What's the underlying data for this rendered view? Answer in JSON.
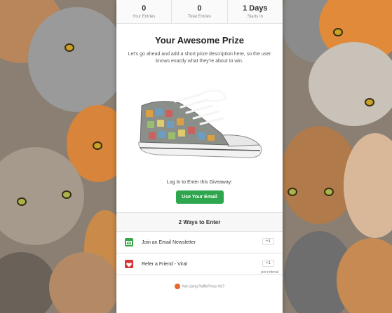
{
  "stats": [
    {
      "value": "0",
      "label": "Your Entries"
    },
    {
      "value": "0",
      "label": "Total Entries"
    },
    {
      "value": "1 Days",
      "label": "Starts In"
    }
  ],
  "prize": {
    "title": "Your Awesome Prize",
    "description": "Let's go ahead and add a short prize description here, so the user knows exactly what they're about to win.",
    "image_icon": "sneaker-image"
  },
  "login": {
    "prompt": "Log In to Enter this Giveaway:",
    "email_button": "Use Your Email"
  },
  "ways": {
    "header": "2 Ways to Enter",
    "items": [
      {
        "label": "Join an Email Newsletter",
        "points": "+1",
        "sub": "",
        "icon": "mail-icon",
        "color": "#3aa54a"
      },
      {
        "label": "Refer a Friend - Viral",
        "points": "+1",
        "sub": "per referral",
        "icon": "heart-icon",
        "color": "#d9343a"
      }
    ]
  },
  "footer": {
    "text": "Not Using RafflePress Yet?"
  },
  "colors": {
    "accent": "#2ea64e",
    "card_bg": "#ffffff"
  }
}
